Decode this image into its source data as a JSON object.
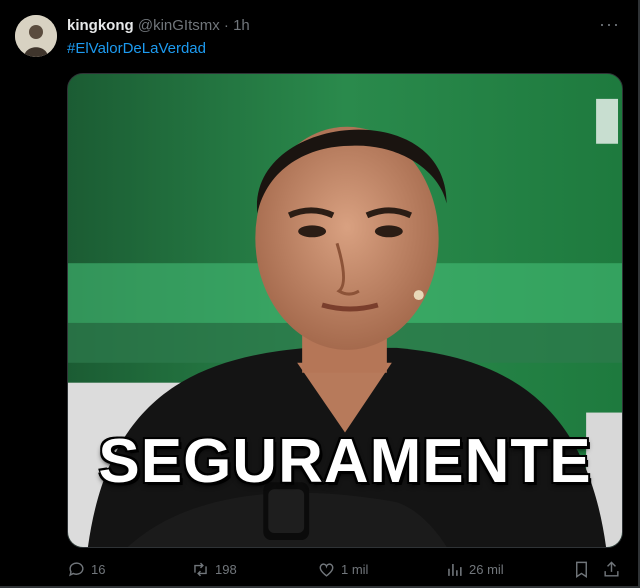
{
  "tweet": {
    "author_name": "kingkong",
    "handle": "@kinGItsmx",
    "separator": " · ",
    "time": "1h",
    "hashtag": "#ElValorDeLaVerdad",
    "media_caption": "SEGURAMENTE"
  },
  "actions": {
    "replies": "16",
    "retweets": "198",
    "likes": "1 mil",
    "views": "26 mil"
  },
  "colors": {
    "background": "#000000",
    "link": "#1d9bf0",
    "muted": "#71767b"
  }
}
